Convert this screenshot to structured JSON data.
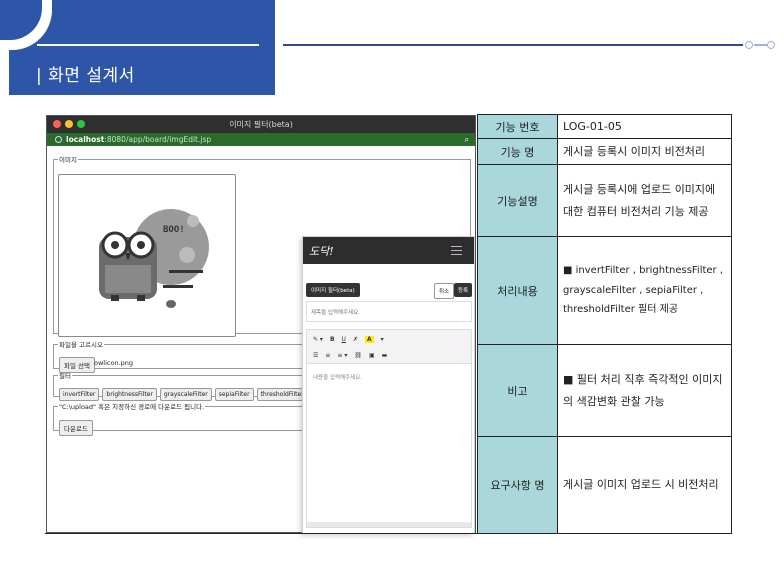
{
  "header": {
    "title": "| 화면 설계서"
  },
  "browser": {
    "window_title": "이미지 필터(beta)",
    "url_host": "localhost",
    "url_path": ":8080/app/board/imgEdit.jsp",
    "sections": {
      "image_legend": "이미지",
      "file_legend": "파일을 고르시오",
      "filter_legend": "필터",
      "download_legend": "\"C:\\upload\" 혹은 지정하신 경로에 다운로드 됩니다."
    },
    "file_button": "파일 선택",
    "file_name": "owlicon.png",
    "filters": [
      "invertFilter",
      "brightnessFilter",
      "grayscaleFilter",
      "sepiaFilter",
      "thresholdFilter"
    ],
    "download_button": "다운로드",
    "preview_text": "BOO!"
  },
  "mobile": {
    "logo": "도닥!",
    "image_filter_button": "이미지 필터(beta)",
    "cancel_button": "취소",
    "submit_button": "등록",
    "subject_placeholder": "제목을 입력해주세요.",
    "content_placeholder": "내용을 입력해주세요.",
    "toolbar_row1": [
      "✎ ▾",
      "B",
      "U",
      "✗",
      "A",
      "▾"
    ],
    "toolbar_row2": [
      "☰",
      "≡",
      "≡ ▾",
      "⛓",
      "▣",
      "▬"
    ]
  },
  "spec": {
    "rows": [
      {
        "label": "기능 번호",
        "value": "LOG-01-05"
      },
      {
        "label": "기능 명",
        "value": "게시글 등록시 이미지 비전처리"
      },
      {
        "label": "기능설명",
        "value": "게시글 등록시에 업로드 이미지에 대한 컴퓨터 비전처리 기능 제공"
      },
      {
        "label": "처리내용",
        "value": "■ invertFilter , brightnessFilter , grayscaleFilter , sepiaFilter , thresholdFilter 필터 제공"
      },
      {
        "label": "비고",
        "value": "■ 필터 처리 직후 즉각적인 이미지의 색감변화 관찰 가능"
      },
      {
        "label": "요구사항 명",
        "value": "게시글 이미지 업로드 시 비전처리"
      }
    ]
  },
  "colors": {
    "header_blue": "#2e56a8",
    "spec_label_bg": "#a9d7dc",
    "address_bar": "#2c6a2c"
  }
}
